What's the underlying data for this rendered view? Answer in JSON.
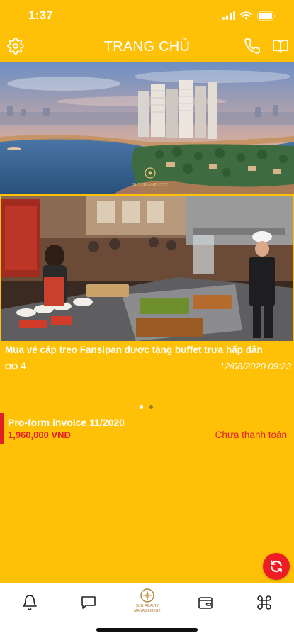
{
  "status_bar": {
    "time": "1:37"
  },
  "header": {
    "title": "TRANG CHỦ",
    "settings_icon": "gear-icon",
    "phone_icon": "phone-icon",
    "guide_icon": "book-icon"
  },
  "banner": {
    "logo_text": "SUN GRAND CITY"
  },
  "news": {
    "title": "Mua vé cáp treo Fansipan được tặng buffet trưa hấp dẫn",
    "views": "4",
    "date": "12/08/2020 09:23"
  },
  "carousel": {
    "page_count": 2,
    "active_index": 0
  },
  "invoice": {
    "title": "Pro-form invoice 11/2020",
    "amount": "1,960,000 VNĐ",
    "status": "Chưa thanh toán"
  },
  "tabbar": {
    "items": [
      {
        "icon": "bell-icon"
      },
      {
        "icon": "chat-icon"
      },
      {
        "icon": "sun-realty-logo",
        "label_top": "SUN REALTY",
        "label_bottom": "MANAGEMENT"
      },
      {
        "icon": "wallet-icon"
      },
      {
        "icon": "command-icon"
      }
    ]
  },
  "colors": {
    "background": "#fec107",
    "accent_red": "#e31e24",
    "text_light": "#ffffff"
  }
}
